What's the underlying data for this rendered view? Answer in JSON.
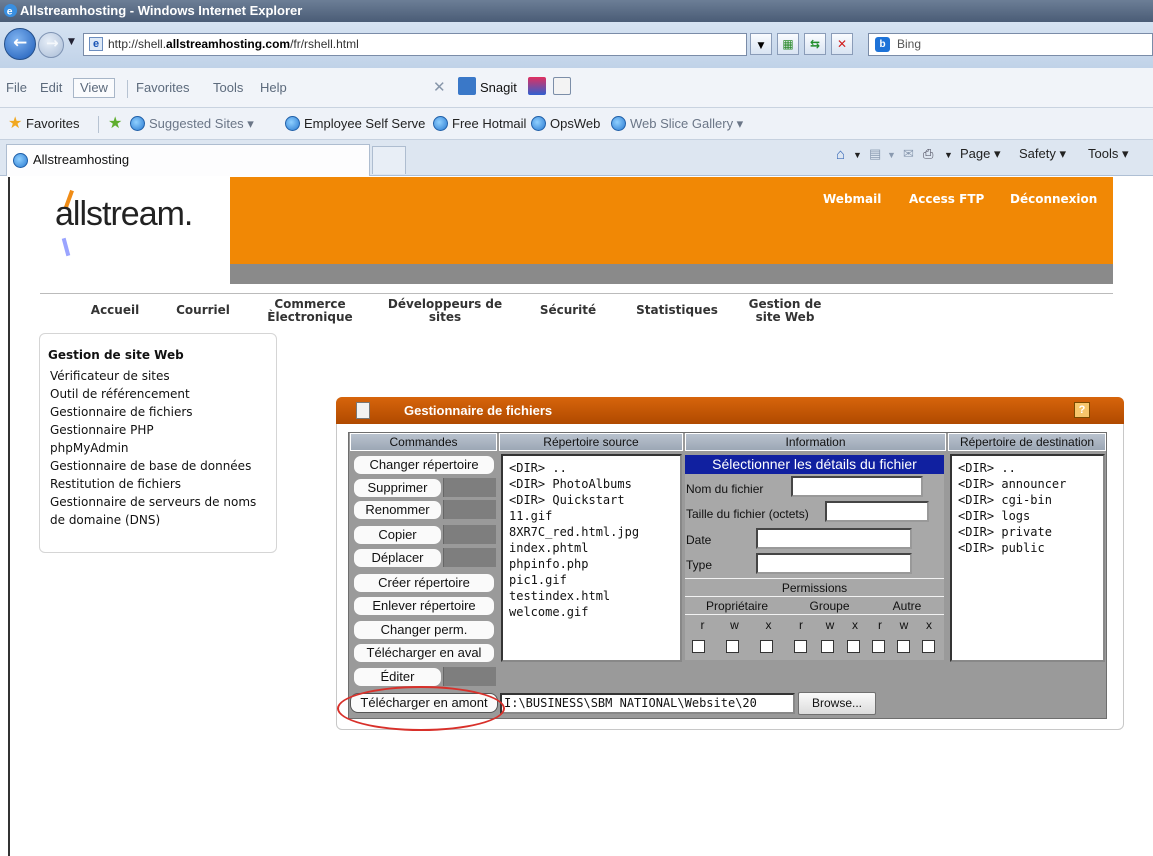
{
  "window": {
    "title": "Allstreamhosting - Windows Internet Explorer"
  },
  "address_bar": {
    "url_prefix": "http://shell.",
    "url_bold": "allstreamhosting.com",
    "url_suffix": "/fr/rshell.html"
  },
  "search": {
    "provider": "Bing"
  },
  "menu": {
    "items": [
      "File",
      "Edit",
      "View",
      "Favorites",
      "Tools",
      "Help"
    ],
    "snagit_label": "Snagit"
  },
  "favorites_bar": {
    "favorites_label": "Favorites",
    "items": [
      "Suggested Sites ▾",
      "Employee Self Serve",
      "Free Hotmail",
      "OpsWeb",
      "Web Slice Gallery ▾"
    ]
  },
  "tab": {
    "title": "Allstreamhosting"
  },
  "command_bar": {
    "page_label": "Page ▾",
    "safety_label": "Safety ▾",
    "tools_label": "Tools ▾"
  },
  "site": {
    "logo_text": "allstream.",
    "top_links": [
      "Webmail",
      "Access FTP",
      "Déconnexion"
    ],
    "nav": [
      {
        "line1": "Accueil",
        "line2": ""
      },
      {
        "line1": "Courriel",
        "line2": ""
      },
      {
        "line1": "Commerce",
        "line2": "Èlectronique"
      },
      {
        "line1": "Développeurs de",
        "line2": "sites"
      },
      {
        "line1": "Sécurité",
        "line2": ""
      },
      {
        "line1": "Statistiques",
        "line2": ""
      },
      {
        "line1": "Gestion de",
        "line2": "site Web"
      }
    ],
    "sidebar": {
      "heading": "Gestion de site Web",
      "items": [
        "Vérificateur de sites",
        "Outil de référencement",
        "Gestionnaire de fichiers",
        "Gestionnaire PHP",
        "phpMyAdmin",
        "Gestionnaire de base de données",
        "Restitution de fichiers",
        "Gestionnaire de serveurs de noms",
        "de domaine (DNS)"
      ]
    }
  },
  "file_manager": {
    "title": "Gestionnaire de fichiers",
    "help": "?",
    "columns": [
      "Commandes",
      "Répertoire source",
      "Information",
      "Répertoire de destination"
    ],
    "commands": [
      "Changer répertoire",
      "Supprimer",
      "Renommer",
      "Copier",
      "Déplacer",
      "Créer répertoire",
      "Enlever répertoire",
      "Changer perm.",
      "Télécharger en aval",
      "Éditer",
      "Télécharger en amont"
    ],
    "source_files": [
      "<DIR> ..",
      "<DIR> PhotoAlbums",
      "<DIR> Quickstart",
      "11.gif",
      "8XR7C_red.html.jpg",
      "index.phtml",
      "phpinfo.php",
      "pic1.gif",
      "testindex.html",
      "welcome.gif"
    ],
    "info": {
      "title": "Sélectionner les détails du fichier",
      "filename_label": "Nom du fichier",
      "size_label": "Taille du fichier (octets)",
      "date_label": "Date",
      "type_label": "Type",
      "permissions_label": "Permissions",
      "groups": [
        "Propriétaire",
        "Groupe",
        "Autre"
      ],
      "perm_letters": [
        "r",
        "w",
        "x",
        "r",
        "w",
        "x",
        "r",
        "w",
        "x"
      ]
    },
    "destination_files": [
      "<DIR> ..",
      "<DIR> announcer",
      "<DIR> cgi-bin",
      "<DIR> logs",
      "<DIR> private",
      "<DIR> public"
    ],
    "upload_path": "I:\\BUSINESS\\SBM NATIONAL\\Website\\20",
    "browse_label": "Browse..."
  },
  "colors": {
    "orange": "#f18805",
    "header_orange": "#c85a05",
    "info_blue": "#1020a0",
    "highlight_red": "#d8302a"
  }
}
